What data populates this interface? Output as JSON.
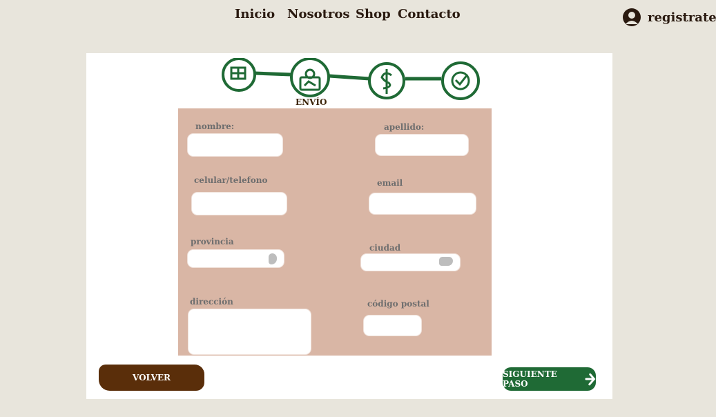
{
  "nav": {
    "items": [
      "Inicio",
      "Nosotros",
      "Shop",
      "Contacto"
    ],
    "register_label": "registrate"
  },
  "steps": {
    "active_label": "ENVÍO",
    "icons": [
      "cart-icon",
      "box-icon",
      "dollar-icon",
      "check-icon"
    ],
    "accent": "#1f6a35"
  },
  "form": {
    "nombre_label": "nombre:",
    "apellido_label": "apellido:",
    "telefono_label": "celular/telefono",
    "email_label": "email",
    "provincia_label": "provincia",
    "ciudad_label": "ciudad",
    "direccion_label": "dirección",
    "cp_label": "código postal",
    "panel_color": "#d9b6a5"
  },
  "buttons": {
    "back_label": "VOLVER",
    "next_label": "SIGUIENTE PASO",
    "back_color": "#5a2e0a",
    "next_color": "#1f6a35"
  }
}
